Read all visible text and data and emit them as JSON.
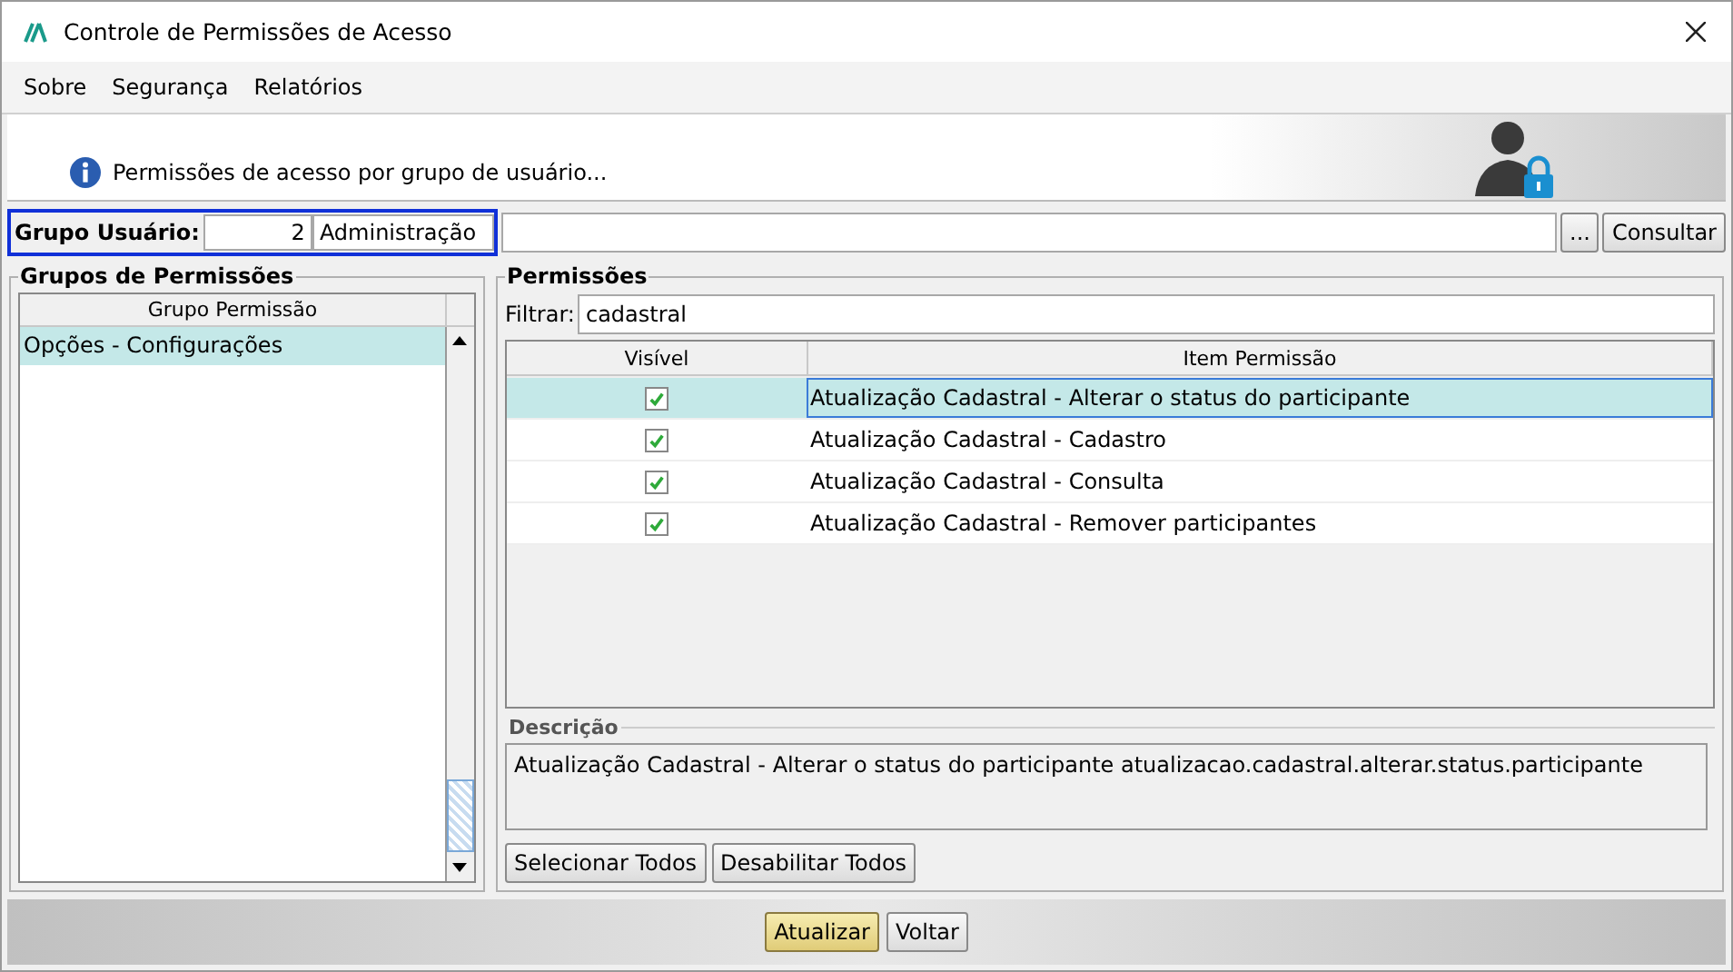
{
  "window": {
    "title": "Controle de Permissões de Acesso"
  },
  "menu": [
    {
      "label": "Sobre"
    },
    {
      "label": "Segurança"
    },
    {
      "label": "Relatórios"
    }
  ],
  "banner": {
    "message": "Permissões de acesso por grupo de usuário..."
  },
  "user_group": {
    "label": "Grupo Usuário:",
    "code": "2",
    "name": "Administração",
    "browse_button": "...",
    "query_button": "Consultar"
  },
  "groups_panel": {
    "title": "Grupos de Permissões",
    "column": "Grupo Permissão",
    "rows": [
      {
        "label": "Opções - Configurações",
        "selected": true
      }
    ]
  },
  "permissions_panel": {
    "title": "Permissões",
    "filter_label": "Filtrar:",
    "filter_value": "cadastral",
    "columns": [
      "Visível",
      "Item Permissão"
    ],
    "rows": [
      {
        "visible": true,
        "item": "Atualização Cadastral - Alterar o status do participante",
        "selected": true
      },
      {
        "visible": true,
        "item": "Atualização Cadastral - Cadastro",
        "selected": false
      },
      {
        "visible": true,
        "item": "Atualização Cadastral - Consulta",
        "selected": false
      },
      {
        "visible": true,
        "item": "Atualização Cadastral - Remover participantes",
        "selected": false
      }
    ],
    "description_title": "Descrição",
    "description": "Atualização Cadastral - Alterar o status do participante atualizacao.cadastral.alterar.status.participante",
    "buttons": [
      "Selecionar Todos",
      "Desabilitar Todos"
    ]
  },
  "footer_buttons": [
    {
      "label": "Atualizar",
      "default": true
    },
    {
      "label": "Voltar",
      "default": false
    }
  ]
}
